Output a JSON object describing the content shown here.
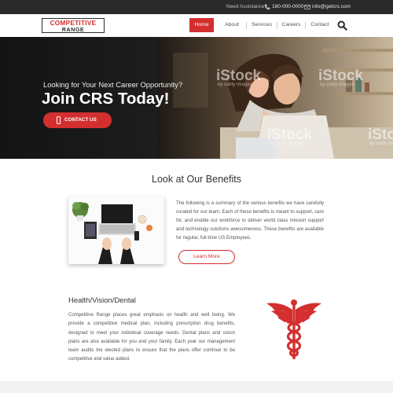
{
  "topbar": {
    "assistance_label": "Need Assistance?",
    "phone": "180-000-0000",
    "email": "info@getcrs.com"
  },
  "logo": {
    "line1": "COMPETITIVE",
    "line2": "RANGE"
  },
  "nav": {
    "items": [
      {
        "label": "Home",
        "active": true
      },
      {
        "label": "About"
      },
      {
        "label": "Services"
      },
      {
        "label": "Careers"
      },
      {
        "label": "Contact"
      }
    ]
  },
  "hero": {
    "kicker": "Looking for Your Next Career Opportunity?",
    "headline": "Join CRS Today!",
    "cta_label": "CONTACT US",
    "watermark": [
      "iStock",
      "by Getty Images"
    ]
  },
  "benefits": {
    "title": "Look at Our Benefits",
    "body": "The following is a summary of the various benefits we have carefully curated for our team. Each of these benefits is meant to support, care for, and enable our workforce to deliver world class mission support and  technology solutions awesomeness. These benefits are available for regular, full-time US Employees.",
    "button_label": "Learn More"
  },
  "health": {
    "title": "Health/Vision/Dental",
    "body": "Competitive Range places great emphasis on health and well being. We provide a competitive medical plan, including prescription drug benefits, designed to meet your individual coverage needs. Dental plans and vision plans are also available for you and your family. Each year our management team audits the elected plans to ensure that the plans offer continue to be competitive and value added."
  },
  "colors": {
    "accent": "#d32f2f",
    "topbar": "#2a2a2a",
    "text": "#555555"
  },
  "icons": [
    "phone-icon",
    "mail-icon",
    "search-icon",
    "mobile-phone-icon",
    "caduceus-icon"
  ]
}
